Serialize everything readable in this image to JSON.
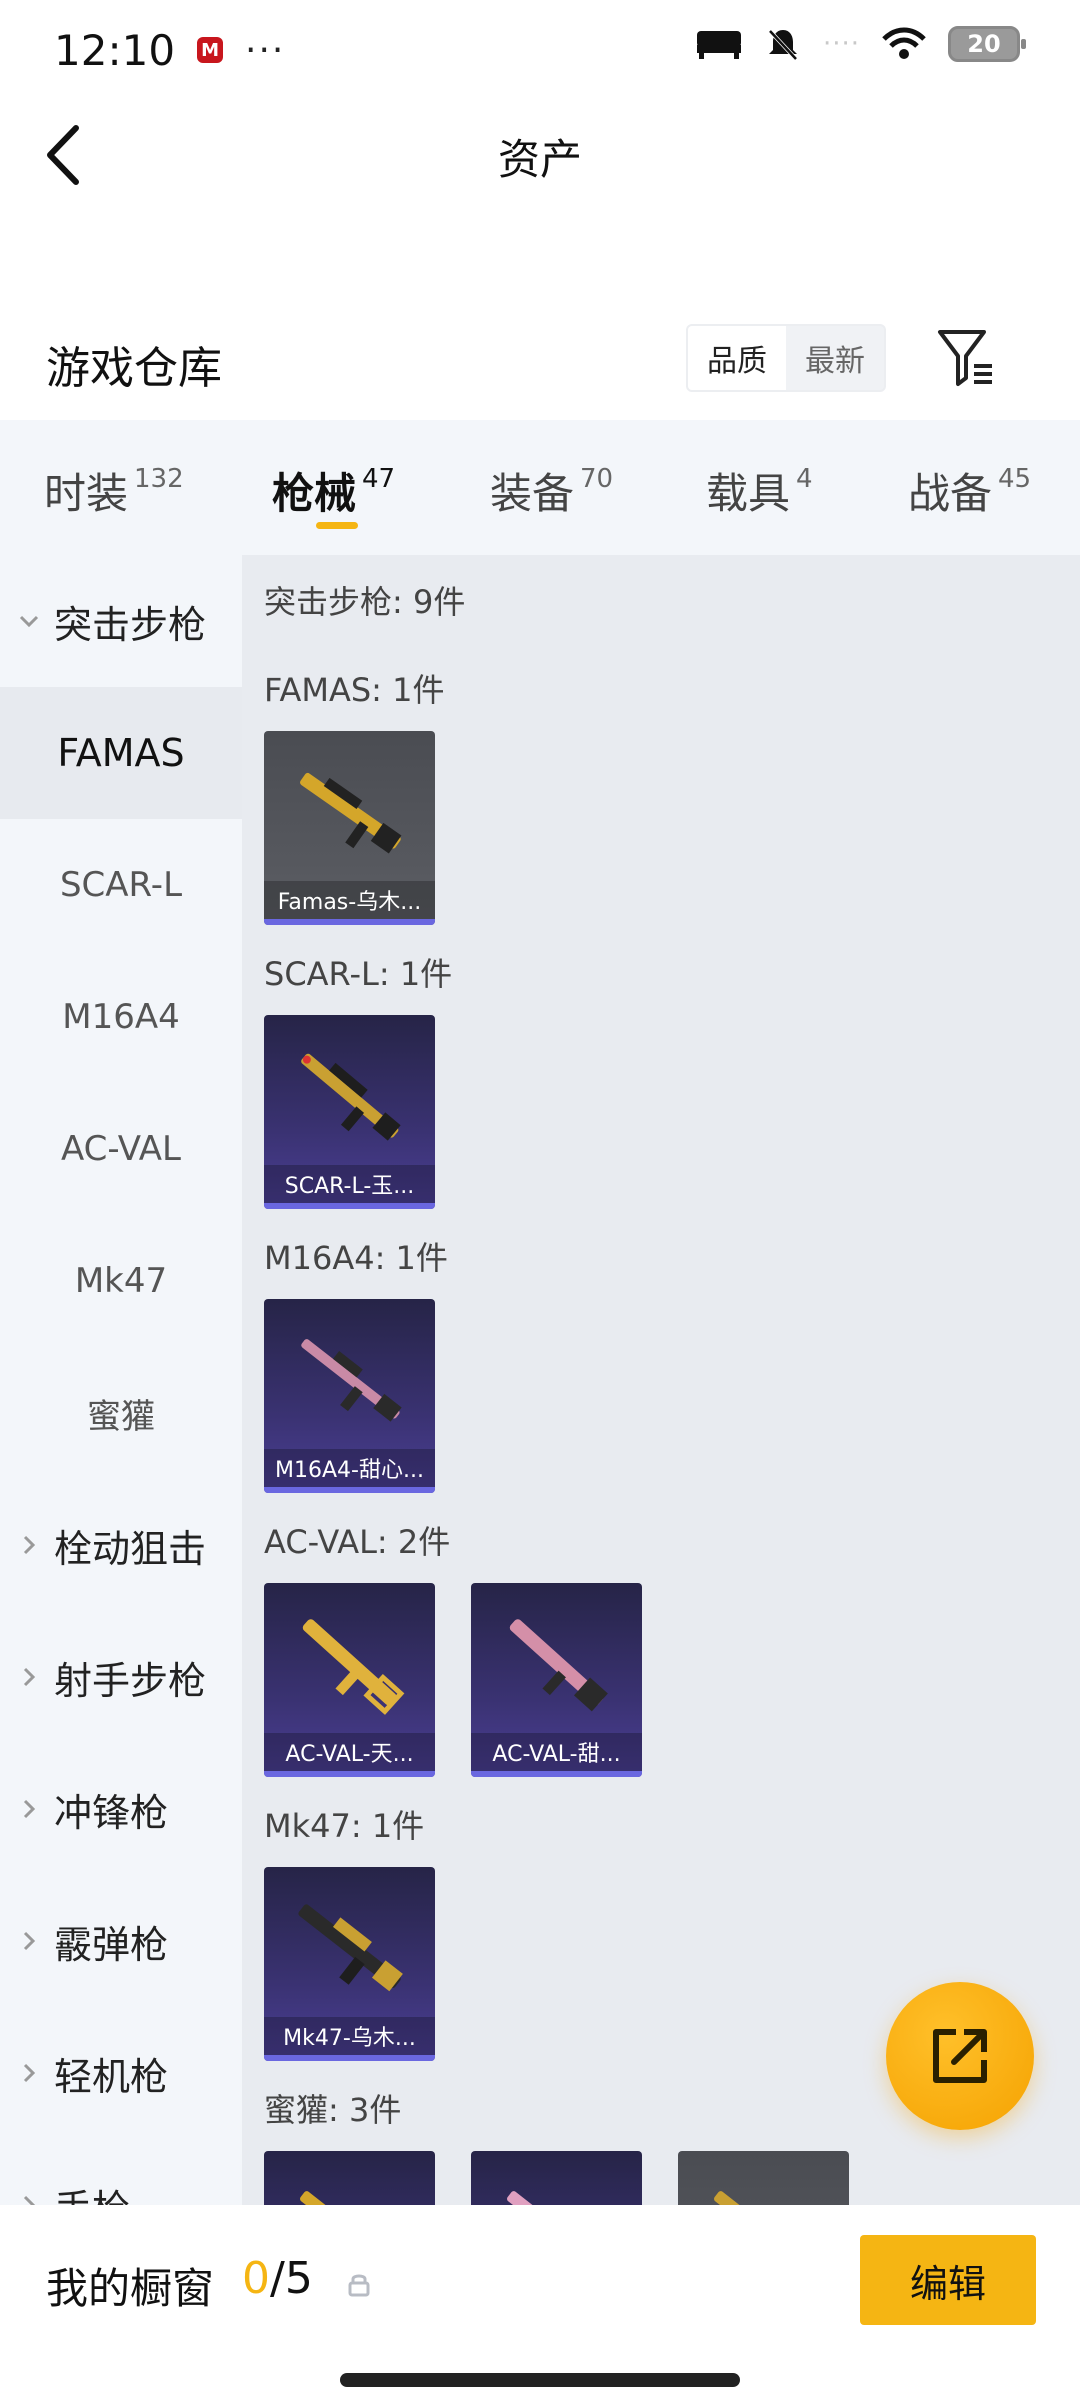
{
  "status": {
    "time": "12:10",
    "app_badge": "M",
    "dots": "···",
    "battery": "20",
    "signal_dots": "····"
  },
  "header": {
    "title": "资产"
  },
  "warehouse": {
    "title": "游戏仓库",
    "seg_quality": "品质",
    "seg_newest": "最新"
  },
  "categories": [
    {
      "label": "时装",
      "count": "132"
    },
    {
      "label": "枪械",
      "count": "47"
    },
    {
      "label": "装备",
      "count": "70"
    },
    {
      "label": "载具",
      "count": "4"
    },
    {
      "label": "战备",
      "count": "45"
    }
  ],
  "sidebar": {
    "group_open": "突击步枪",
    "subs": [
      "FAMAS",
      "SCAR-L",
      "M16A4",
      "AC-VAL",
      "Mk47",
      "蜜獾"
    ],
    "groups": [
      "栓动狙击",
      "射手步枪",
      "冲锋枪",
      "霰弹枪",
      "轻机枪",
      "手枪"
    ]
  },
  "content": {
    "summary": "突击步枪: 9件",
    "sections": [
      {
        "label": "FAMAS: 1件",
        "items": [
          "Famas-乌木..."
        ]
      },
      {
        "label": "SCAR-L: 1件",
        "items": [
          "SCAR-L-玉..."
        ]
      },
      {
        "label": "M16A4: 1件",
        "items": [
          "M16A4-甜心..."
        ]
      },
      {
        "label": "AC-VAL: 2件",
        "items": [
          "AC-VAL-天...",
          "AC-VAL-甜..."
        ]
      },
      {
        "label": "Mk47: 1件",
        "items": [
          "Mk47-乌木..."
        ]
      },
      {
        "label": "蜜獾: 3件",
        "items": [
          "",
          "",
          ""
        ]
      }
    ]
  },
  "bottom": {
    "showcase": "我的橱窗",
    "count_current": "0",
    "count_total": "/5",
    "edit": "编辑"
  },
  "colors": {
    "accent": "#f5b513",
    "card_purple": "#3a3272",
    "card_gray": "#5c5e64"
  }
}
